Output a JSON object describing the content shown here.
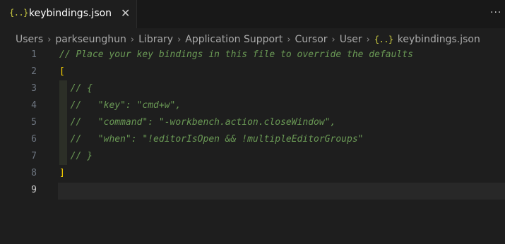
{
  "tab": {
    "icon": "{..}",
    "icon_name": "json-braces-icon",
    "label": "keybindings.json",
    "close": "✕"
  },
  "more_actions": "···",
  "breadcrumb": {
    "items": [
      "Users",
      "parkseunghun",
      "Library",
      "Application Support",
      "Cursor",
      "User"
    ],
    "file_icon": "{..}",
    "file": "keybindings.json",
    "separator": "›"
  },
  "editor": {
    "active_line": 9,
    "lines": [
      {
        "number": "1",
        "text": "// Place your key bindings in this file to override the defaults"
      },
      {
        "number": "2",
        "text": "["
      },
      {
        "number": "3",
        "text": "  // {"
      },
      {
        "number": "4",
        "text": "  //   \"key\": \"cmd+w\","
      },
      {
        "number": "5",
        "text": "  //   \"command\": \"-workbench.action.closeWindow\","
      },
      {
        "number": "6",
        "text": "  //   \"when\": \"!editorIsOpen && !multipleEditorGroups\""
      },
      {
        "number": "7",
        "text": "  // }"
      },
      {
        "number": "8",
        "text": "]"
      },
      {
        "number": "9",
        "text": ""
      }
    ]
  },
  "colors": {
    "background": "#1e1e1e",
    "comment": "#6a9955",
    "bracket": "#ffd700",
    "json_icon": "#cbcb41"
  }
}
